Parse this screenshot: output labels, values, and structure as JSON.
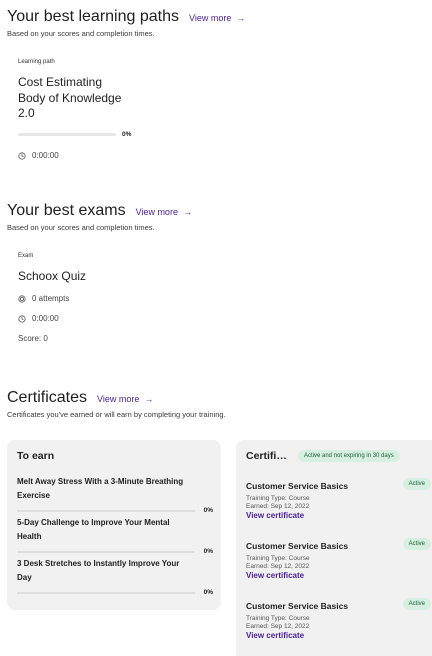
{
  "learning_paths": {
    "title": "Your best learning paths",
    "view_more": "View more",
    "subtitle": "Based on your scores and completion times.",
    "item": {
      "kind": "Learning path",
      "title_lines": [
        "Cost Estimating",
        "Body of Knowledge",
        "2.0"
      ],
      "progress": 0,
      "progress_label": "0%",
      "time": "0:00:00"
    }
  },
  "exams": {
    "title": "Your best exams",
    "view_more": "View more",
    "subtitle": "Based on your scores and completion times.",
    "item": {
      "kind": "Exam",
      "title": "Schoox Quiz",
      "attempts": "0 attempts",
      "time": "0:00:00",
      "score": "Score: 0"
    }
  },
  "certificates": {
    "title": "Certificates",
    "view_more": "View more",
    "subtitle": "Certificates you've earned or will earn by completing your training.",
    "to_earn": {
      "title": "To earn",
      "items": [
        {
          "title_lines": [
            "Melt Away Stress With a 3-Minute Breathing",
            "Exercise"
          ],
          "progress": 0,
          "progress_label": "0%"
        },
        {
          "title_lines": [
            "5-Day Challenge to Improve Your Mental",
            "Health"
          ],
          "progress": 0,
          "progress_label": "0%"
        },
        {
          "title_lines": [
            "3 Desk Stretches to Instantly Improve Your",
            "Day"
          ],
          "progress": 0,
          "progress_label": "0%"
        }
      ]
    },
    "earned": {
      "title": "Certifi…",
      "filter_badge": "Active and not expiring in 30 days",
      "items": [
        {
          "name": "Customer Service Basics",
          "status": "Active",
          "type": "Training Type: Course",
          "earned": "Earned: Sep 12, 2022",
          "link": "View certificate"
        },
        {
          "name": "Customer Service Basics",
          "status": "Active",
          "type": "Training Type: Course",
          "earned": "Earned: Sep 12, 2022",
          "link": "View certificate"
        },
        {
          "name": "Customer Service Basics",
          "status": "Active",
          "type": "Training Type: Course",
          "earned": "Earned: Sep 12, 2022",
          "link": "View certificate"
        }
      ]
    }
  },
  "colors": {
    "accent": "#4a1f9a",
    "badge_bg": "#d6efe0",
    "badge_text": "#1d5f37",
    "card_bg": "#f1f1f1"
  },
  "icons": {
    "clock": "clock-icon",
    "attempts": "target-icon",
    "arrow": "arrow-right-icon"
  }
}
